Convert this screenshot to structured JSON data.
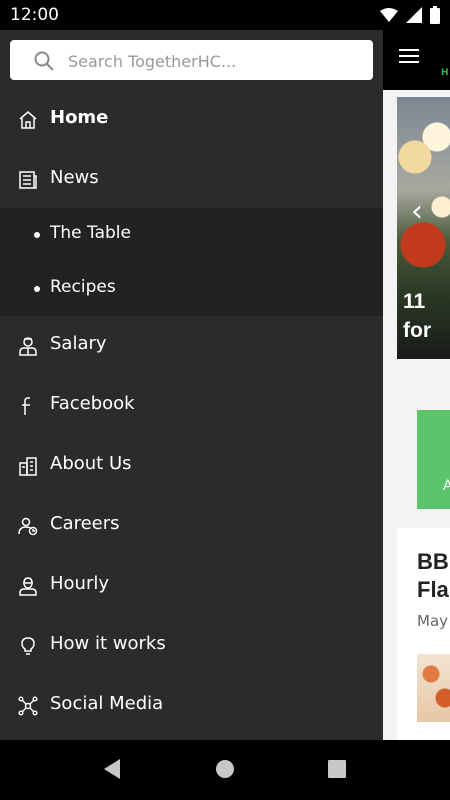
{
  "status": {
    "time": "12:00"
  },
  "search": {
    "placeholder": "Search TogetherHC..."
  },
  "menu": {
    "home": "Home",
    "news": "News",
    "the_table": "The Table",
    "recipes": "Recipes",
    "salary": "Salary",
    "facebook": "Facebook",
    "about_us": "About Us",
    "careers": "Careers",
    "hourly": "Hourly",
    "how_it_works": "How it works",
    "social_media": "Social Media"
  },
  "content": {
    "hero_caption_line1": "11",
    "hero_caption_line2": "for",
    "green_box_text": "A",
    "card_title_line1": "BB",
    "card_title_line2": "Fla",
    "card_date": "May",
    "appbar_green_text": "H"
  },
  "colors": {
    "accent_green": "#5cc46a",
    "drawer_bg": "#2b2b2b",
    "submenu_bg": "#222222"
  },
  "icons": [
    "menu-icon",
    "search-icon",
    "home-icon",
    "news-icon",
    "salary-icon",
    "facebook-icon",
    "about-us-icon",
    "careers-icon",
    "hourly-icon",
    "lightbulb-icon",
    "social-media-icon",
    "back-icon",
    "home-nav-icon",
    "recents-icon"
  ]
}
